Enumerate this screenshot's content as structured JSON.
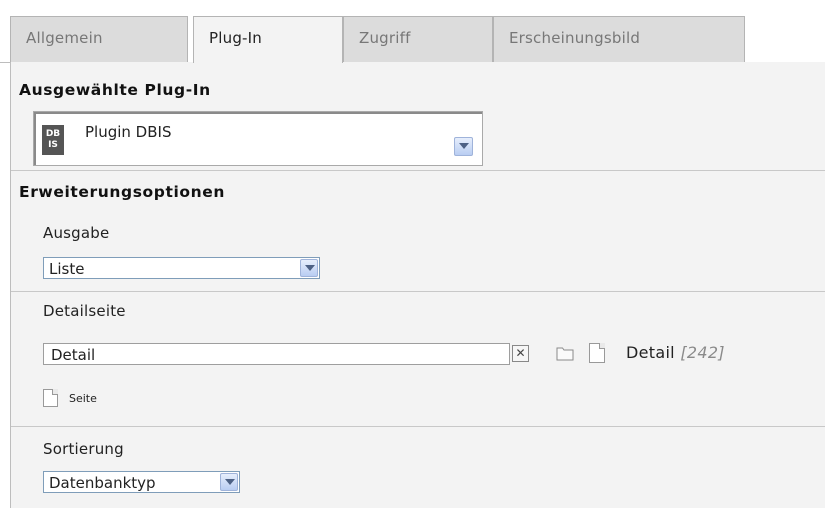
{
  "tabs": [
    {
      "label": "Allgemein",
      "active": false
    },
    {
      "label": "Plug-In",
      "active": true
    },
    {
      "label": "Zugriff",
      "active": false
    },
    {
      "label": "Erscheinungsbild",
      "active": false
    }
  ],
  "plugin_section": {
    "title": "Ausgewählte Plug-In",
    "icon_text_top": "DB",
    "icon_text_bottom": "IS",
    "selected": "Plugin DBIS"
  },
  "extension_section": {
    "title": "Erweiterungsoptionen",
    "ausgabe": {
      "label": "Ausgabe",
      "value": "Liste"
    },
    "detailseite": {
      "label": "Detailseite",
      "input_value": "Detail",
      "clear_symbol": "✕",
      "reference_title": "Detail",
      "reference_uid": "[242]",
      "page_link_label": "Seite"
    },
    "sortierung": {
      "label": "Sortierung",
      "value": "Datenbanktyp"
    }
  },
  "colors": {
    "tab_active": "#f3f3f3",
    "tab_inactive": "#dcdcdc",
    "panel_bg": "#f3f3f3",
    "dropdown_button": "#b9cdf2"
  },
  "icons": [
    "plugin-dbis-icon",
    "dropdown-arrow-icon",
    "clear-icon",
    "folder-icon",
    "page-icon"
  ]
}
